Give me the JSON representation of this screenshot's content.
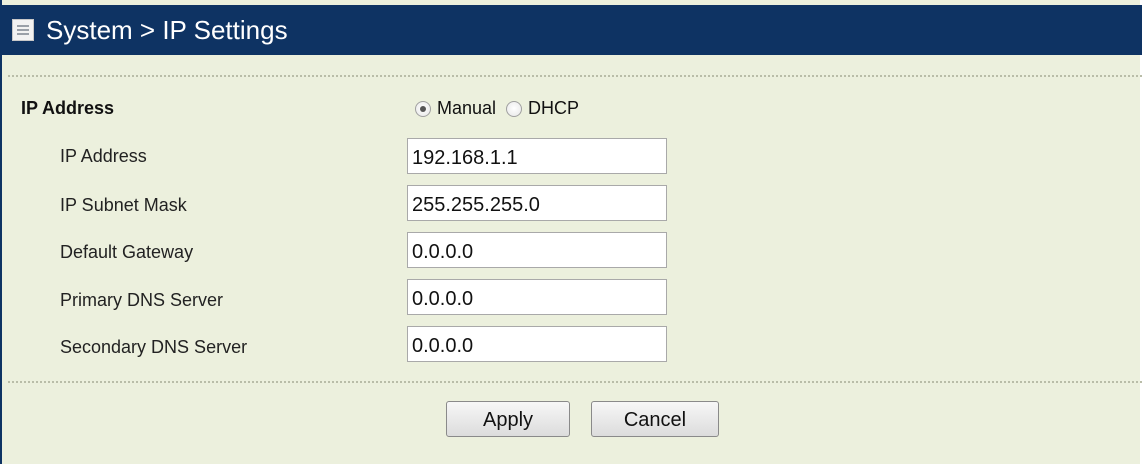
{
  "header": {
    "title": "System > IP Settings",
    "icon": "document-list-icon"
  },
  "ip_mode": {
    "label": "IP Address",
    "options": [
      {
        "label": "Manual",
        "selected": true
      },
      {
        "label": "DHCP",
        "selected": false
      }
    ]
  },
  "fields": [
    {
      "label": "IP Address",
      "value": "192.168.1.1"
    },
    {
      "label": "IP Subnet Mask",
      "value": "255.255.255.0"
    },
    {
      "label": "Default Gateway",
      "value": "0.0.0.0"
    },
    {
      "label": "Primary DNS Server",
      "value": "0.0.0.0"
    },
    {
      "label": "Secondary DNS Server",
      "value": "0.0.0.0"
    }
  ],
  "buttons": {
    "apply_label": "Apply",
    "cancel_label": "Cancel"
  },
  "colors": {
    "header_bg": "#0e3363",
    "panel_bg": "#ecf0dd"
  }
}
